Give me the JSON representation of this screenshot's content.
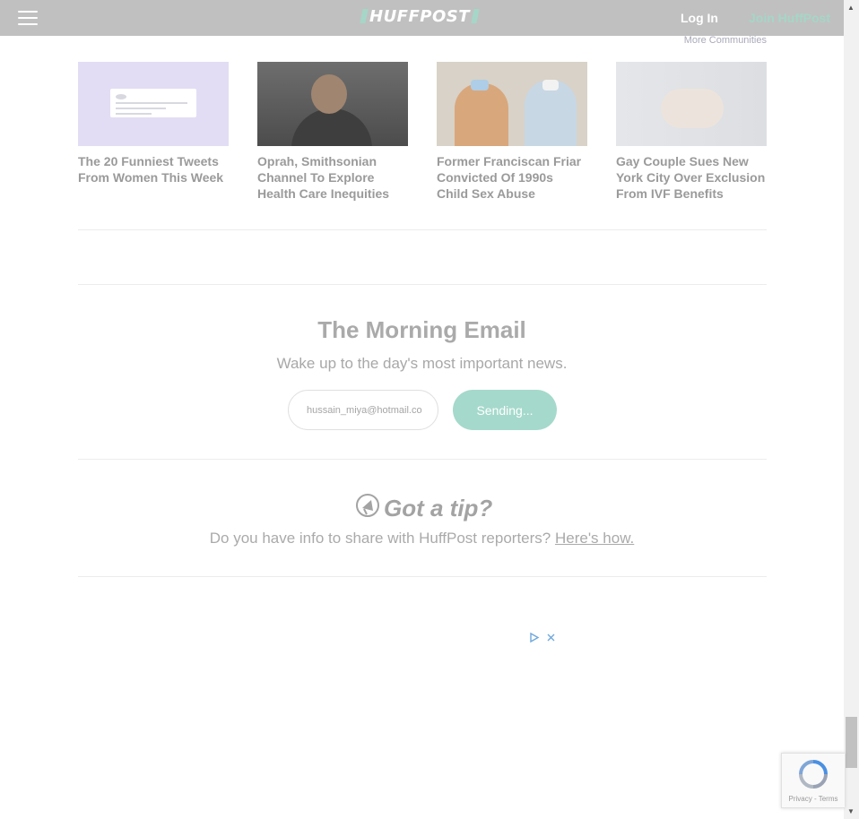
{
  "header": {
    "logo": "HUFFPOST",
    "login_label": "Log In",
    "join_label": "Join HuffPost",
    "colors": {
      "bar": "#c0c0c0",
      "accent": "#a5d6c7"
    }
  },
  "more_communities": "More Communities",
  "cards": [
    {
      "title": "The 20 Funniest Tweets From Women This Week",
      "image": "tweet-screenshot"
    },
    {
      "title": "Oprah, Smithsonian Channel To Explore Health Care Inequities",
      "image": "oprah-photo"
    },
    {
      "title": "Former Franciscan Friar Convicted Of 1990s Child Sex Abuse",
      "image": "friar-courtroom-photo"
    },
    {
      "title": "Gay Couple Sues New York City Over Exclusion From IVF Benefits",
      "image": "newborn-photo"
    }
  ],
  "newsletter": {
    "title": "The Morning Email",
    "subtitle": "Wake up to the day's most important news.",
    "email_value": "hussain_miya@hotmail.co",
    "button_label": "Sending...",
    "button_color": "#a5d9cb"
  },
  "tip": {
    "title": "Got a tip?",
    "text": "Do you have info to share with HuffPost reporters?",
    "link": "Here's how."
  },
  "recaptcha": {
    "terms": "Privacy - Terms"
  },
  "icons": {
    "menu": "hamburger-menu-icon",
    "tip": "megaphone-icon",
    "adchoices": "adchoices-icon",
    "ad_close": "close-icon",
    "recaptcha": "recaptcha-icon"
  }
}
